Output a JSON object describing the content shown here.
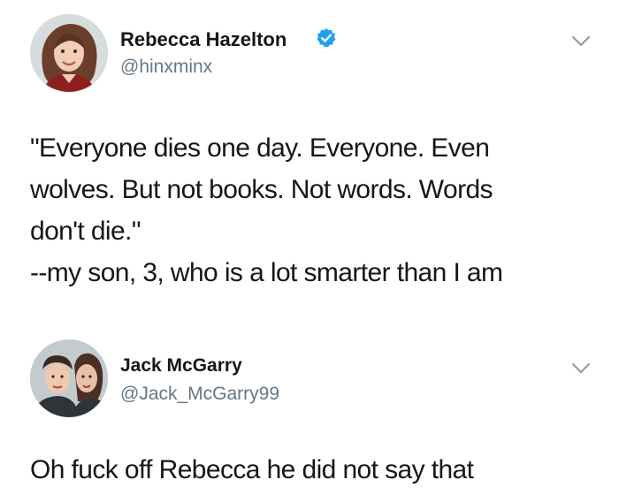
{
  "tweets": [
    {
      "author": {
        "name": "Rebecca Hazelton",
        "handle": "@hinxminx",
        "verified": true
      },
      "text_lines": [
        "\"Everyone dies one day. Everyone. Even",
        "wolves. But not books. Not words. Words",
        "don't die.\"",
        "--my son, 3, who is a lot smarter than I am"
      ]
    },
    {
      "author": {
        "name": "Jack McGarry",
        "handle": "@Jack_McGarry99",
        "verified": false
      },
      "text_lines": [
        "Oh fuck off Rebecca he did not say that"
      ]
    }
  ],
  "colors": {
    "verified_badge": "#1da1f2",
    "handle_text": "#657786",
    "chevron": "#8899a6"
  },
  "icons": [
    "verified-badge-icon",
    "chevron-down-icon"
  ]
}
